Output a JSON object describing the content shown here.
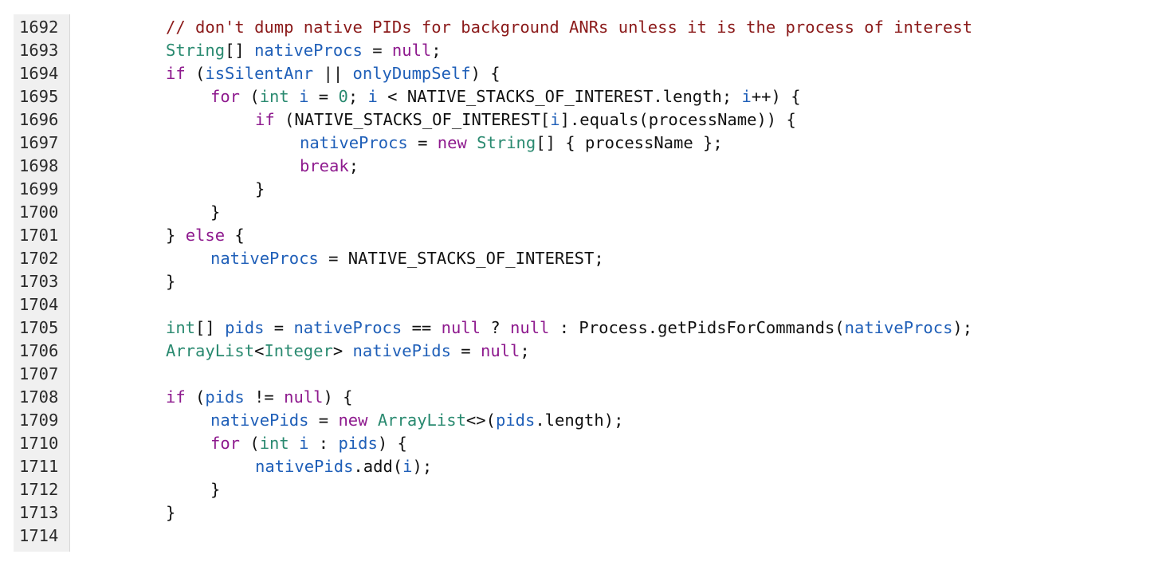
{
  "colors": {
    "background": "#ffffff",
    "gutter": "#f0f0f0",
    "comment": "#8b1a1a",
    "keyword": "#8e1a8e",
    "type": "#2a8a70",
    "variable": "#1f5fb8",
    "plain": "#111111"
  },
  "lines": [
    {
      "num": "1692",
      "indent": 2,
      "tokens": [
        [
          "comment",
          "// don't dump native PIDs for background ANRs unless it is the process of interest"
        ]
      ]
    },
    {
      "num": "1693",
      "indent": 2,
      "tokens": [
        [
          "type",
          "String"
        ],
        [
          "plain",
          "[] "
        ],
        [
          "var",
          "nativeProcs"
        ],
        [
          "plain",
          " = "
        ],
        [
          "keyword",
          "null"
        ],
        [
          "plain",
          ";"
        ]
      ]
    },
    {
      "num": "1694",
      "indent": 2,
      "tokens": [
        [
          "keyword",
          "if"
        ],
        [
          "plain",
          " ("
        ],
        [
          "var",
          "isSilentAnr"
        ],
        [
          "plain",
          " || "
        ],
        [
          "var",
          "onlyDumpSelf"
        ],
        [
          "plain",
          ") {"
        ]
      ]
    },
    {
      "num": "1695",
      "indent": 3,
      "tokens": [
        [
          "keyword",
          "for"
        ],
        [
          "plain",
          " ("
        ],
        [
          "type",
          "int"
        ],
        [
          "plain",
          " "
        ],
        [
          "var",
          "i"
        ],
        [
          "plain",
          " = "
        ],
        [
          "number",
          "0"
        ],
        [
          "plain",
          "; "
        ],
        [
          "var",
          "i"
        ],
        [
          "plain",
          " < NATIVE_STACKS_OF_INTEREST.length; "
        ],
        [
          "var",
          "i"
        ],
        [
          "plain",
          "++) {"
        ]
      ]
    },
    {
      "num": "1696",
      "indent": 4,
      "tokens": [
        [
          "keyword",
          "if"
        ],
        [
          "plain",
          " (NATIVE_STACKS_OF_INTEREST["
        ],
        [
          "var",
          "i"
        ],
        [
          "plain",
          "].equals(processName)) {"
        ]
      ]
    },
    {
      "num": "1697",
      "indent": 5,
      "tokens": [
        [
          "var",
          "nativeProcs"
        ],
        [
          "plain",
          " = "
        ],
        [
          "keyword",
          "new"
        ],
        [
          "plain",
          " "
        ],
        [
          "type",
          "String"
        ],
        [
          "plain",
          "[] { processName };"
        ]
      ]
    },
    {
      "num": "1698",
      "indent": 5,
      "tokens": [
        [
          "keyword",
          "break"
        ],
        [
          "plain",
          ";"
        ]
      ]
    },
    {
      "num": "1699",
      "indent": 4,
      "tokens": [
        [
          "plain",
          "}"
        ]
      ]
    },
    {
      "num": "1700",
      "indent": 3,
      "tokens": [
        [
          "plain",
          "}"
        ]
      ]
    },
    {
      "num": "1701",
      "indent": 2,
      "tokens": [
        [
          "plain",
          "} "
        ],
        [
          "keyword",
          "else"
        ],
        [
          "plain",
          " {"
        ]
      ]
    },
    {
      "num": "1702",
      "indent": 3,
      "tokens": [
        [
          "var",
          "nativeProcs"
        ],
        [
          "plain",
          " = NATIVE_STACKS_OF_INTEREST;"
        ]
      ]
    },
    {
      "num": "1703",
      "indent": 2,
      "tokens": [
        [
          "plain",
          "}"
        ]
      ]
    },
    {
      "num": "1704",
      "indent": 0,
      "tokens": []
    },
    {
      "num": "1705",
      "indent": 2,
      "tokens": [
        [
          "type",
          "int"
        ],
        [
          "plain",
          "[] "
        ],
        [
          "var",
          "pids"
        ],
        [
          "plain",
          " = "
        ],
        [
          "var",
          "nativeProcs"
        ],
        [
          "plain",
          " == "
        ],
        [
          "keyword",
          "null"
        ],
        [
          "plain",
          " ? "
        ],
        [
          "keyword",
          "null"
        ],
        [
          "plain",
          " : Process.getPidsForCommands("
        ],
        [
          "var",
          "nativeProcs"
        ],
        [
          "plain",
          ");"
        ]
      ]
    },
    {
      "num": "1706",
      "indent": 2,
      "tokens": [
        [
          "type",
          "ArrayList"
        ],
        [
          "plain",
          "<"
        ],
        [
          "type",
          "Integer"
        ],
        [
          "plain",
          "> "
        ],
        [
          "var",
          "nativePids"
        ],
        [
          "plain",
          " = "
        ],
        [
          "keyword",
          "null"
        ],
        [
          "plain",
          ";"
        ]
      ]
    },
    {
      "num": "1707",
      "indent": 0,
      "tokens": []
    },
    {
      "num": "1708",
      "indent": 2,
      "tokens": [
        [
          "keyword",
          "if"
        ],
        [
          "plain",
          " ("
        ],
        [
          "var",
          "pids"
        ],
        [
          "plain",
          " != "
        ],
        [
          "keyword",
          "null"
        ],
        [
          "plain",
          ") {"
        ]
      ]
    },
    {
      "num": "1709",
      "indent": 3,
      "tokens": [
        [
          "var",
          "nativePids"
        ],
        [
          "plain",
          " = "
        ],
        [
          "keyword",
          "new"
        ],
        [
          "plain",
          " "
        ],
        [
          "type",
          "ArrayList"
        ],
        [
          "plain",
          "<>("
        ],
        [
          "var",
          "pids"
        ],
        [
          "plain",
          ".length);"
        ]
      ]
    },
    {
      "num": "1710",
      "indent": 3,
      "tokens": [
        [
          "keyword",
          "for"
        ],
        [
          "plain",
          " ("
        ],
        [
          "type",
          "int"
        ],
        [
          "plain",
          " "
        ],
        [
          "var",
          "i"
        ],
        [
          "plain",
          " : "
        ],
        [
          "var",
          "pids"
        ],
        [
          "plain",
          ") {"
        ]
      ]
    },
    {
      "num": "1711",
      "indent": 4,
      "tokens": [
        [
          "var",
          "nativePids"
        ],
        [
          "plain",
          ".add("
        ],
        [
          "var",
          "i"
        ],
        [
          "plain",
          ");"
        ]
      ]
    },
    {
      "num": "1712",
      "indent": 3,
      "tokens": [
        [
          "plain",
          "}"
        ]
      ]
    },
    {
      "num": "1713",
      "indent": 2,
      "tokens": [
        [
          "plain",
          "}"
        ]
      ]
    },
    {
      "num": "1714",
      "indent": 0,
      "tokens": []
    }
  ]
}
